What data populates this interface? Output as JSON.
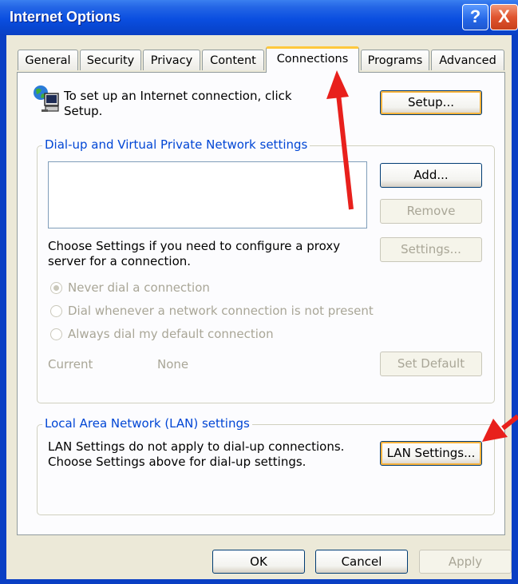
{
  "window": {
    "title": "Internet Options"
  },
  "titlebar": {
    "help_label": "?",
    "close_label": "X"
  },
  "tabs": [
    {
      "label": "General"
    },
    {
      "label": "Security"
    },
    {
      "label": "Privacy"
    },
    {
      "label": "Content"
    },
    {
      "label": "Connections",
      "active": true
    },
    {
      "label": "Programs"
    },
    {
      "label": "Advanced"
    }
  ],
  "setup": {
    "text": "To set up an Internet connection, click Setup.",
    "button_label": "Setup..."
  },
  "dialup": {
    "group_label": "Dial-up and Virtual Private Network settings",
    "add_label": "Add...",
    "remove_label": "Remove",
    "proxy_text": "Choose Settings if you need to configure a proxy server for a connection.",
    "settings_label": "Settings...",
    "radios": [
      {
        "label": "Never dial a connection",
        "selected": true
      },
      {
        "label": "Dial whenever a network connection is not present",
        "selected": false
      },
      {
        "label": "Always dial my default connection",
        "selected": false
      }
    ],
    "current_label": "Current",
    "current_value": "None",
    "set_default_label": "Set Default"
  },
  "lan": {
    "group_label": "Local Area Network (LAN) settings",
    "text": "LAN Settings do not apply to dial-up connections. Choose Settings above for dial-up settings.",
    "button_label": "LAN Settings..."
  },
  "footer": {
    "ok_label": "OK",
    "cancel_label": "Cancel",
    "apply_label": "Apply"
  },
  "colors": {
    "annotation_arrow": "#e8201c",
    "group_label": "#0046d5",
    "title_bar": "#0a4ee0"
  },
  "icons": [
    "connection-globe-computer-icon",
    "help-icon",
    "close-icon"
  ]
}
